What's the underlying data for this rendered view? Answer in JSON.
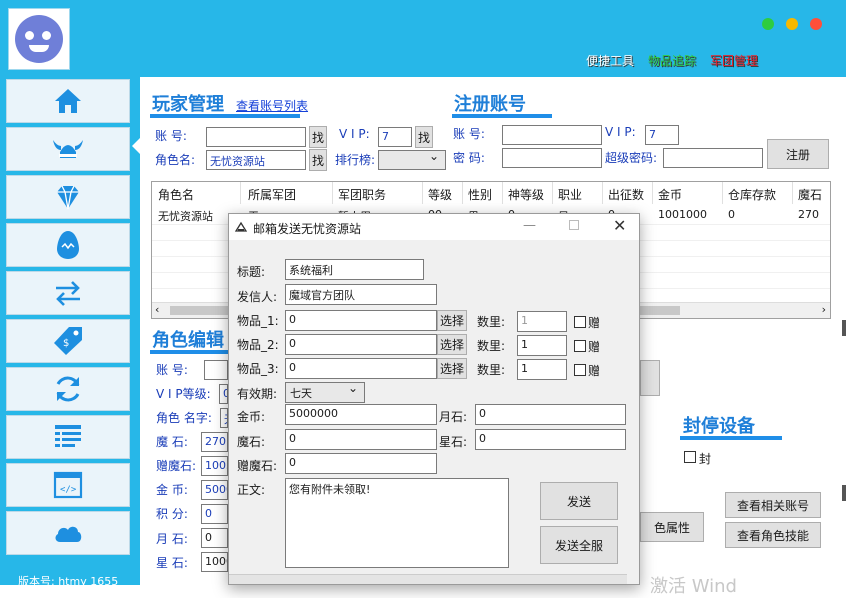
{
  "header": {
    "tools": [
      {
        "label": "便捷工具",
        "color": "#ffffff"
      },
      {
        "label": "物品追踪",
        "color": "#2ecc40"
      },
      {
        "label": "军团管理",
        "color": "#e8202a"
      }
    ],
    "window_dots": [
      "#2ecc40",
      "#f5b800",
      "#ff4f3a"
    ]
  },
  "sidebar": {
    "items": [
      "home-icon",
      "viking-helmet-icon",
      "diamond-icon",
      "egg-icon",
      "swap-arrows-icon",
      "price-tag-icon",
      "refresh-icon",
      "list-icon",
      "code-window-icon",
      "cloud-icon"
    ],
    "version": "版本号: htmy 1655"
  },
  "player_mgmt": {
    "title": "玩家管理",
    "view_list_link": "查看账号列表",
    "account_label": "账    号:",
    "account_value": "",
    "find_btn": "找",
    "vip_label": "V I P:",
    "vip_value": "7",
    "role_label": "角色名:",
    "role_value": "无忧资源站",
    "rank_label": "排行榜:",
    "rank_value": ""
  },
  "register": {
    "title": "注册账号",
    "account_label": "账    号:",
    "account_value": "",
    "vip_label": "V I P:",
    "vip_value": "7",
    "password_label": "密    码:",
    "password_value": "",
    "super_pw_label": "超级密码:",
    "super_pw_value": "",
    "register_btn": "注册"
  },
  "table": {
    "columns": [
      "角色名",
      "所属军团",
      "军团职务",
      "等级",
      "性别",
      "神等级",
      "职业",
      "出征数",
      "金币",
      "仓库存款",
      "魔石"
    ],
    "rows": [
      [
        "无忧资源站",
        "无",
        "暂人用",
        "00",
        "男",
        "0",
        "星",
        "0",
        "1001000",
        "0",
        "270"
      ]
    ]
  },
  "role_edit": {
    "title": "角色编辑",
    "labels": [
      "账    号:",
      "V I P等级:",
      "角色 名字:",
      "魔    石:",
      "赠魔石:",
      "金    币:",
      "积    分:",
      "月    石:",
      "星    石:"
    ],
    "values": [
      "",
      "0",
      "无",
      "270",
      "1003",
      "5000",
      "0",
      "0",
      "1000"
    ]
  },
  "ban": {
    "title": "封停设备",
    "checkbox_label": "封",
    "view_related_btn": "查看相关账号",
    "view_skill_btn": "查看角色技能",
    "attr_btn": "色属性"
  },
  "mail_dialog": {
    "title": "邮箱发送无忧资源站",
    "subject_label": "标题:",
    "subject_value": "系统福利",
    "sender_label": "发信人:",
    "sender_value": "魔域官方团队",
    "item1_label": "物品_1:",
    "item1_value": "0",
    "item2_label": "物品_2:",
    "item2_value": "0",
    "item3_label": "物品_3:",
    "item3_value": "0",
    "select_btn": "选择",
    "qty_label": "数里:",
    "qty1_value": "1",
    "qty2_value": "1",
    "qty3_value": "1",
    "gift_label": "赠",
    "expire_label": "有效期:",
    "expire_value": "七天",
    "gold_label": "金币:",
    "gold_value": "5000000",
    "moonstone_label": "月石:",
    "moonstone_value": "0",
    "magicstone_label": "魔石:",
    "magicstone_value": "0",
    "starstone_label": "星石:",
    "starstone_value": "0",
    "gift_stone_label": "赠魔石:",
    "gift_stone_value": "0",
    "body_label": "正文:",
    "body_value": "您有附件未领取!",
    "send_btn": "发送",
    "send_all_btn": "发送全服"
  },
  "watermark": "激活 Wind"
}
